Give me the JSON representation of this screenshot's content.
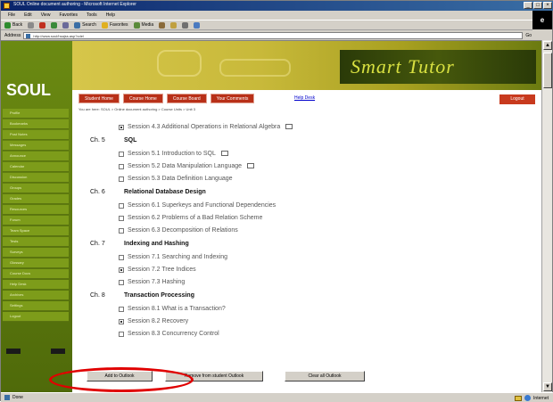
{
  "window": {
    "title": "SOUL Online document authoring - Microsoft Internet Explorer"
  },
  "menu": [
    "File",
    "Edit",
    "View",
    "Favorites",
    "Tools",
    "Help"
  ],
  "toolbar": {
    "back": "Back",
    "search": "Search",
    "favorites": "Favorites",
    "media": "Media"
  },
  "address": {
    "label": "Address",
    "url": "http://www.soul/hsajss.asp?cdel",
    "go": "Go"
  },
  "sidebar": {
    "logo": "SOUL",
    "items": [
      "Profile",
      "Bookmarks",
      "Post Notes",
      "Messages",
      "Announce",
      "Calendar",
      "Discussion",
      "Groups",
      "Grades",
      "Resources",
      "Forum",
      "Team Space",
      "Tests",
      "Surveys",
      "Glossary",
      "Course Docs",
      "Help Desk",
      "Archives",
      "Settings",
      "Logout"
    ]
  },
  "banner": {
    "brand": "Smart Tutor"
  },
  "nav": {
    "tabs": [
      "Student Home",
      "Course Home",
      "Course Board",
      "Your Comments"
    ],
    "help": "Help Desk",
    "logout": "Logout",
    "path": "You are here: SOUL > Online document authoring > Course Units > Unit 3"
  },
  "tree": {
    "top_session": "Session 4.3  Additional Operations in Relational Algebra",
    "chapters": [
      {
        "num": "Ch. 5",
        "title": "SQL",
        "sessions": [
          {
            "label": "Session 5.1  Introduction to SQL",
            "checked": false,
            "icon": true
          },
          {
            "label": "Session 5.2  Data Manipulation Language",
            "checked": false,
            "icon": true
          },
          {
            "label": "Session 5.3  Data Definition Language",
            "checked": false,
            "icon": false
          }
        ]
      },
      {
        "num": "Ch. 6",
        "title": "Relational Database Design",
        "sessions": [
          {
            "label": "Session 6.1  Superkeys and Functional Dependencies",
            "checked": false,
            "icon": false
          },
          {
            "label": "Session 6.2  Problems of a Bad Relation Scheme",
            "checked": false,
            "icon": false
          },
          {
            "label": "Session 6.3  Decomposition of Relations",
            "checked": false,
            "icon": false
          }
        ]
      },
      {
        "num": "Ch. 7",
        "title": "Indexing and Hashing",
        "sessions": [
          {
            "label": "Session 7.1  Searching and Indexing",
            "checked": false,
            "icon": false
          },
          {
            "label": "Session 7.2  Tree Indices",
            "checked": true,
            "icon": false
          },
          {
            "label": "Session 7.3  Hashing",
            "checked": false,
            "icon": false
          }
        ]
      },
      {
        "num": "Ch. 8",
        "title": "Transaction Processing",
        "sessions": [
          {
            "label": "Session 8.1  What is a Transaction?",
            "checked": false,
            "icon": false
          },
          {
            "label": "Session 8.2  Recovery",
            "checked": true,
            "icon": false
          },
          {
            "label": "Session 8.3  Concurrency Control",
            "checked": false,
            "icon": false
          }
        ]
      }
    ]
  },
  "buttons": {
    "add": "Add to Outlook",
    "remove": "Remove from student Outlook",
    "clear": "Clear all Outlook"
  },
  "status": {
    "left": "Done",
    "zone": "Internet"
  },
  "colors": {
    "sidebar": "#5a7410",
    "tab": "#b83018",
    "highlight": "#e00000"
  }
}
